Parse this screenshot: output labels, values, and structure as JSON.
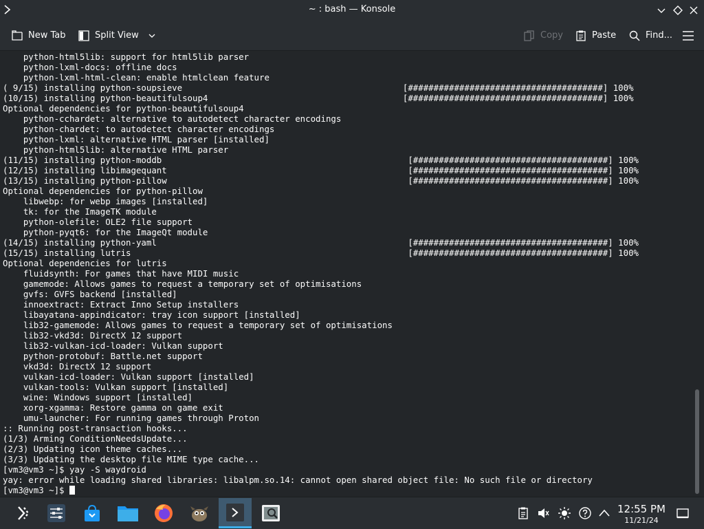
{
  "window": {
    "title": "~ : bash — Konsole",
    "icons": [
      "konsole-app-icon",
      "minimize-icon",
      "maximize-icon",
      "close-icon"
    ]
  },
  "toolbar": {
    "new_tab": "New Tab",
    "split_view": "Split View",
    "copy": "Copy",
    "paste": "Paste",
    "find": "Find...",
    "icons": [
      "new-tab-icon",
      "split-view-icon",
      "chevron-down-icon",
      "copy-icon",
      "paste-icon",
      "search-icon",
      "hamburger-menu-icon"
    ]
  },
  "terminal": {
    "lines": [
      "    python-html5lib: support for html5lib parser",
      "    python-lxml-docs: offline docs",
      "    python-lxml-html-clean: enable htmlclean feature",
      "( 9/15) installing python-soupsieve                                           [######################################] 100%",
      "(10/15) installing python-beautifulsoup4                                      [######################################] 100%",
      "Optional dependencies for python-beautifulsoup4",
      "    python-cchardet: alternative to autodetect character encodings",
      "    python-chardet: to autodetect character encodings",
      "    python-lxml: alternative HTML parser [installed]",
      "    python-html5lib: alternative HTML parser",
      "(11/15) installing python-moddb                                                [######################################] 100%",
      "(12/15) installing libimagequant                                               [######################################] 100%",
      "(13/15) installing python-pillow                                               [######################################] 100%",
      "Optional dependencies for python-pillow",
      "    libwebp: for webp images [installed]",
      "    tk: for the ImageTK module",
      "    python-olefile: OLE2 file support",
      "    python-pyqt6: for the ImageQt module",
      "(14/15) installing python-yaml                                                 [######################################] 100%",
      "(15/15) installing lutris                                                      [######################################] 100%",
      "Optional dependencies for lutris",
      "    fluidsynth: For games that have MIDI music",
      "    gamemode: Allows games to request a temporary set of optimisations",
      "    gvfs: GVFS backend [installed]",
      "    innoextract: Extract Inno Setup installers",
      "    libayatana-appindicator: tray icon support [installed]",
      "    lib32-gamemode: Allows games to request a temporary set of optimisations",
      "    lib32-vkd3d: DirectX 12 support",
      "    lib32-vulkan-icd-loader: Vulkan support",
      "    python-protobuf: Battle.net support",
      "    vkd3d: DirectX 12 support",
      "    vulkan-icd-loader: Vulkan support [installed]",
      "    vulkan-tools: Vulkan support [installed]",
      "    wine: Windows support [installed]",
      "    xorg-xgamma: Restore gamma on game exit",
      "    umu-launcher: For running games through Proton",
      ":: Running post-transaction hooks...",
      "(1/3) Arming ConditionNeedsUpdate...",
      "(2/3) Updating icon theme caches...",
      "(3/3) Updating the desktop file MIME type cache...",
      "[vm3@vm3 ~]$ yay -S waydroid",
      "yay: error while loading shared libraries: libalpm.so.14: cannot open shared object file: No such file or directory"
    ],
    "prompt": "[vm3@vm3 ~]$ "
  },
  "taskbar": {
    "launchers": [
      "app-launcher-icon",
      "system-settings-icon",
      "discover-store-icon",
      "dolphin-files-icon",
      "firefox-icon",
      "gimp-icon",
      "konsole-task-icon",
      "image-viewer-icon"
    ],
    "tray": [
      "clipboard-icon",
      "volume-muted-icon",
      "brightness-icon",
      "help-icon",
      "tray-expand-icon",
      "show-desktop-icon"
    ],
    "time": "12:55 PM",
    "date": "11/21/24"
  }
}
